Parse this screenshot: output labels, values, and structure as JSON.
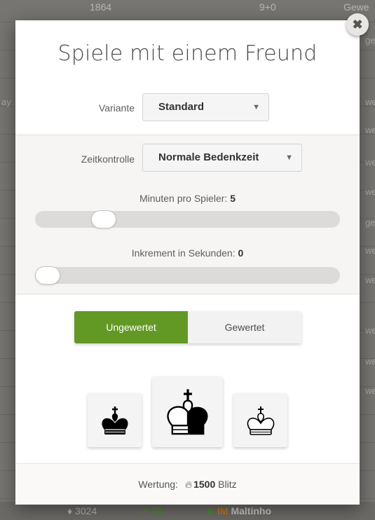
{
  "background": {
    "top_row": {
      "rating": "1864",
      "time": "9+0",
      "player_fragment": "Gewe"
    },
    "right_fragments": [
      "ge",
      "we",
      "we",
      "we",
      "we",
      "ge",
      "we",
      "we",
      "we",
      "we",
      "we",
      "we"
    ],
    "left_fragment": "ay",
    "footer": {
      "rating": "3024",
      "change": "24",
      "title": "IM",
      "player": "Maltinho"
    }
  },
  "dialog": {
    "title": "Spiele mit einem Freund",
    "close_icon": "close-icon",
    "variant": {
      "label": "Variante",
      "value": "Standard"
    },
    "time_control": {
      "label": "Zeitkontrolle",
      "value": "Normale Bedenkzeit"
    },
    "minutes": {
      "label": "Minuten pro Spieler: ",
      "value": "5",
      "level_fraction": 0.2
    },
    "increment": {
      "label": "Inkrement in Sekunden: ",
      "value": "0",
      "level_fraction": 0.0
    },
    "modes": {
      "unrated": "Ungewertet",
      "rated": "Gewertet",
      "selected": "unrated"
    },
    "color_choices": [
      "black-king-icon",
      "random-king-icon",
      "white-king-icon"
    ],
    "rating": {
      "label": "Wertung: ",
      "icon": "fire-icon",
      "value": "1500",
      "speed": "Blitz"
    }
  },
  "colors": {
    "accent_green": "#629924",
    "panel_bg": "#f6f5f4",
    "track": "#dcdbd9"
  }
}
